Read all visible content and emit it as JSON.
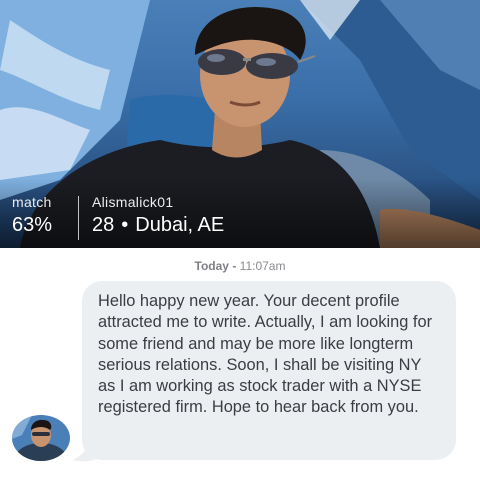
{
  "profile": {
    "match_label": "match",
    "match_value": "63%",
    "username": "Alismalick01",
    "age": "28",
    "separator": "•",
    "location": "Dubai, AE"
  },
  "chat": {
    "timestamp_day": "Today",
    "timestamp_sep": " - ",
    "timestamp_time": "11:07am",
    "message": "Hello happy new year. Your decent profile attracted me to write. Actually, I am looking for some friend and may be more like longterm serious relations. Soon, I shall be visiting NY as I am working as stock trader with a NYSE registered firm. Hope to hear back from you."
  }
}
